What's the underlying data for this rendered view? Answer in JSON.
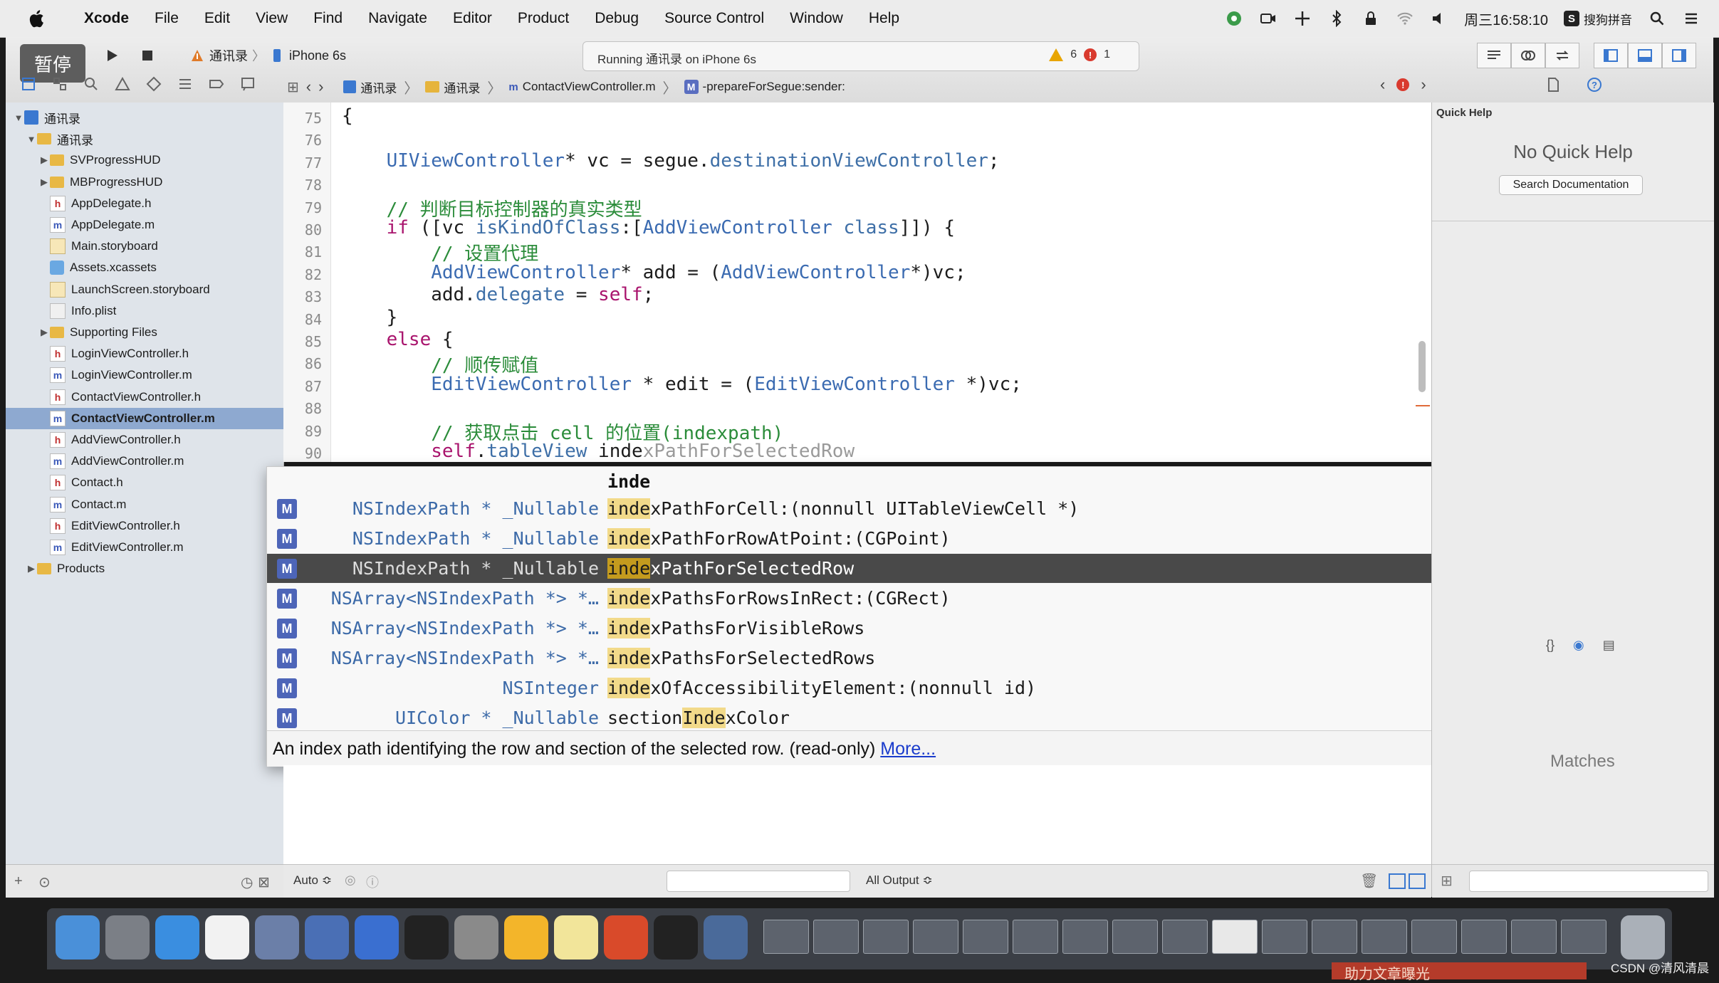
{
  "menubar": {
    "app": "Xcode",
    "items": [
      "File",
      "Edit",
      "View",
      "Find",
      "Navigate",
      "Editor",
      "Product",
      "Debug",
      "Source Control",
      "Window",
      "Help"
    ],
    "clock": "周三16:58:10",
    "input_method": "搜狗拼音"
  },
  "toolbar": {
    "pause_badge": "暂停",
    "scheme_target": "通讯录",
    "scheme_device": "iPhone 6s",
    "activity_text": "Running 通讯录 on iPhone 6s",
    "warning_count": "6",
    "error_count": "1"
  },
  "jumpbar": {
    "project": "通讯录",
    "group": "通讯录",
    "file": "ContactViewController.m",
    "method_badge": "M",
    "method": "-prepareForSegue:sender:"
  },
  "navigator": {
    "items": [
      {
        "label": "通讯录",
        "kind": "proj",
        "level": 0,
        "disclosure": "▼"
      },
      {
        "label": "通讯录",
        "kind": "folder",
        "level": 1,
        "disclosure": "▼"
      },
      {
        "label": "SVProgressHUD",
        "kind": "folder",
        "level": 2,
        "disclosure": "▶"
      },
      {
        "label": "MBProgressHUD",
        "kind": "folder",
        "level": 2,
        "disclosure": "▶"
      },
      {
        "label": "AppDelegate.h",
        "kind": "h",
        "level": 2
      },
      {
        "label": "AppDelegate.m",
        "kind": "m",
        "level": 2
      },
      {
        "label": "Main.storyboard",
        "kind": "sb",
        "level": 2
      },
      {
        "label": "Assets.xcassets",
        "kind": "assets",
        "level": 2
      },
      {
        "label": "LaunchScreen.storyboard",
        "kind": "sb",
        "level": 2
      },
      {
        "label": "Info.plist",
        "kind": "plist",
        "level": 2
      },
      {
        "label": "Supporting Files",
        "kind": "folder",
        "level": 2,
        "disclosure": "▶"
      },
      {
        "label": "LoginViewController.h",
        "kind": "h",
        "level": 2
      },
      {
        "label": "LoginViewController.m",
        "kind": "m",
        "level": 2
      },
      {
        "label": "ContactViewController.h",
        "kind": "h",
        "level": 2
      },
      {
        "label": "ContactViewController.m",
        "kind": "m",
        "level": 2,
        "selected": true
      },
      {
        "label": "AddViewController.h",
        "kind": "h",
        "level": 2
      },
      {
        "label": "AddViewController.m",
        "kind": "m",
        "level": 2
      },
      {
        "label": "Contact.h",
        "kind": "h",
        "level": 2
      },
      {
        "label": "Contact.m",
        "kind": "m",
        "level": 2
      },
      {
        "label": "EditViewController.h",
        "kind": "h",
        "level": 2
      },
      {
        "label": "EditViewController.m",
        "kind": "m",
        "level": 2
      },
      {
        "label": "Products",
        "kind": "folder",
        "level": 1,
        "disclosure": "▶"
      }
    ]
  },
  "editor": {
    "lines": [
      {
        "n": "75",
        "segs": [
          [
            "{",
            ""
          ]
        ]
      },
      {
        "n": "76",
        "segs": []
      },
      {
        "n": "77",
        "segs": [
          [
            "    ",
            ""
          ],
          [
            "UIViewController",
            "ty"
          ],
          [
            "* vc = segue.",
            ""
          ],
          [
            "destinationViewController",
            "pr"
          ],
          [
            ";",
            ""
          ]
        ]
      },
      {
        "n": "78",
        "segs": []
      },
      {
        "n": "79",
        "segs": [
          [
            "    ",
            ""
          ],
          [
            "// 判断目标控制器的真实类型",
            "cm"
          ]
        ]
      },
      {
        "n": "80",
        "segs": [
          [
            "    ",
            ""
          ],
          [
            "if",
            "kw"
          ],
          [
            " ([vc ",
            ""
          ],
          [
            "isKindOfClass",
            "pr"
          ],
          [
            ":[",
            ""
          ],
          [
            "AddViewController",
            "ty"
          ],
          [
            " ",
            ""
          ],
          [
            "class",
            "pr"
          ],
          [
            "]]) {",
            ""
          ]
        ]
      },
      {
        "n": "81",
        "segs": [
          [
            "        ",
            ""
          ],
          [
            "// 设置代理",
            "cm"
          ]
        ]
      },
      {
        "n": "82",
        "segs": [
          [
            "        ",
            ""
          ],
          [
            "AddViewController",
            "ty"
          ],
          [
            "* add = (",
            ""
          ],
          [
            "AddViewController",
            "ty"
          ],
          [
            "*)vc;",
            ""
          ]
        ]
      },
      {
        "n": "83",
        "segs": [
          [
            "        add.",
            ""
          ],
          [
            "delegate",
            "pr"
          ],
          [
            " = ",
            ""
          ],
          [
            "self",
            "kw"
          ],
          [
            ";",
            ""
          ]
        ]
      },
      {
        "n": "84",
        "segs": [
          [
            "    }",
            ""
          ]
        ]
      },
      {
        "n": "85",
        "segs": [
          [
            "    ",
            ""
          ],
          [
            "else",
            "kw"
          ],
          [
            " {",
            ""
          ]
        ]
      },
      {
        "n": "86",
        "segs": [
          [
            "        ",
            ""
          ],
          [
            "// 顺传赋值",
            "cm"
          ]
        ]
      },
      {
        "n": "87",
        "segs": [
          [
            "        ",
            ""
          ],
          [
            "EditViewController",
            "ty"
          ],
          [
            " * edit = (",
            ""
          ],
          [
            "EditViewController",
            "ty"
          ],
          [
            " *)vc;",
            ""
          ]
        ]
      },
      {
        "n": "88",
        "segs": []
      },
      {
        "n": "89",
        "segs": [
          [
            "        ",
            ""
          ],
          [
            "// 获取点击 cell 的位置(indexpath)",
            "cm"
          ]
        ]
      },
      {
        "n": "90",
        "segs": [
          [
            "        ",
            ""
          ],
          [
            "self",
            "kw"
          ],
          [
            ".",
            ""
          ],
          [
            "tableView",
            "pr"
          ],
          [
            " inde",
            ""
          ],
          [
            "xPathForSelectedRow",
            "ghost"
          ]
        ]
      }
    ]
  },
  "completion": {
    "typed": "inde",
    "items": [
      {
        "badge": "M",
        "type": "NSIndexPath * _Nullable",
        "hl": "inde",
        "rest": "xPathForCell:(nonnull UITableViewCell *)"
      },
      {
        "badge": "M",
        "type": "NSIndexPath * _Nullable",
        "hl": "inde",
        "rest": "xPathForRowAtPoint:(CGPoint)"
      },
      {
        "badge": "M",
        "type": "NSIndexPath * _Nullable",
        "hl": "inde",
        "rest": "xPathForSelectedRow",
        "selected": true
      },
      {
        "badge": "M",
        "type": "NSArray<NSIndexPath *> *…",
        "hl": "inde",
        "rest": "xPathsForRowsInRect:(CGRect)"
      },
      {
        "badge": "M",
        "type": "NSArray<NSIndexPath *> *…",
        "hl": "inde",
        "rest": "xPathsForVisibleRows"
      },
      {
        "badge": "M",
        "type": "NSArray<NSIndexPath *> *…",
        "hl": "inde",
        "rest": "xPathsForSelectedRows"
      },
      {
        "badge": "M",
        "type": "NSInteger",
        "hl": "inde",
        "rest": "xOfAccessibilityElement:(nonnull id)"
      },
      {
        "badge": "M",
        "type": "UIColor * _Nullable",
        "pre": "section",
        "hl": "Inde",
        "rest": "xColor"
      }
    ],
    "description": "An index path identifying the row and section of the selected row. (read-only)",
    "more_link": "More..."
  },
  "debug": {
    "variables_scope": "Auto ≎",
    "console_output": "All Output ≎"
  },
  "inspector": {
    "title": "Quick Help",
    "no_help": "No Quick Help",
    "search_docs": "Search Documentation",
    "matches": "Matches",
    "lib_tabs": [
      "{}",
      "◉",
      "▤"
    ]
  },
  "dock": {
    "icons": [
      "finder-icon",
      "launchpad-icon",
      "safari-icon",
      "mouse-icon",
      "photo-slideshow-icon",
      "xcode-icon",
      "instruments-icon",
      "terminal-icon",
      "system-preferences-icon",
      "sketch-icon",
      "notes-icon",
      "presentation-icon",
      "console-icon",
      "quicktime-icon"
    ],
    "window_thumbnails": 17
  },
  "overlay": {
    "watermark": "CSDN @清风清晨",
    "behind_strip": "助力文章曝光"
  },
  "colors": {
    "keyword": "#a9146d",
    "type": "#3b6bb1",
    "comment": "#2b8c3a",
    "selection": "#8ea9d0",
    "completion_selected": "#494949",
    "highlight": "#f2da8a"
  }
}
